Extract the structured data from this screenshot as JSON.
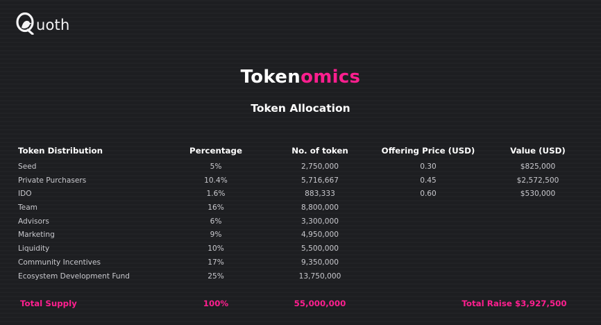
{
  "brand": {
    "logo_icon": "quoth-bird-q-icon",
    "name_rest": "uoth"
  },
  "title": {
    "part1": "Token",
    "part2": "omics",
    "accent_color": "#ff1f8f"
  },
  "subtitle": "Token Allocation",
  "table": {
    "headers": {
      "distribution": "Token Distribution",
      "percentage": "Percentage",
      "tokens": "No. of token",
      "price": "Offering Price (USD)",
      "value": "Value (USD)"
    },
    "rows": [
      {
        "name": "Seed",
        "pct": "5%",
        "tokens": "2,750,000",
        "price": "0.30",
        "value": "$825,000"
      },
      {
        "name": "Private Purchasers",
        "pct": "10.4%",
        "tokens": "5,716,667",
        "price": "0.45",
        "value": "$2,572,500"
      },
      {
        "name": "IDO",
        "pct": "1.6%",
        "tokens": "883,333",
        "price": "0.60",
        "value": "$530,000"
      },
      {
        "name": "Team",
        "pct": "16%",
        "tokens": "8,800,000",
        "price": "",
        "value": ""
      },
      {
        "name": "Advisors",
        "pct": "6%",
        "tokens": "3,300,000",
        "price": "",
        "value": ""
      },
      {
        "name": "Marketing",
        "pct": "9%",
        "tokens": "4,950,000",
        "price": "",
        "value": ""
      },
      {
        "name": "Liquidity",
        "pct": "10%",
        "tokens": "5,500,000",
        "price": "",
        "value": ""
      },
      {
        "name": "Community Incentives",
        "pct": "17%",
        "tokens": "9,350,000",
        "price": "",
        "value": ""
      },
      {
        "name": "Ecosystem Development Fund",
        "pct": "25%",
        "tokens": "13,750,000",
        "price": "",
        "value": ""
      }
    ],
    "total": {
      "label": "Total Supply",
      "pct": "100%",
      "tokens": "55,000,000",
      "raise": "Total Raise $3,927,500"
    }
  }
}
